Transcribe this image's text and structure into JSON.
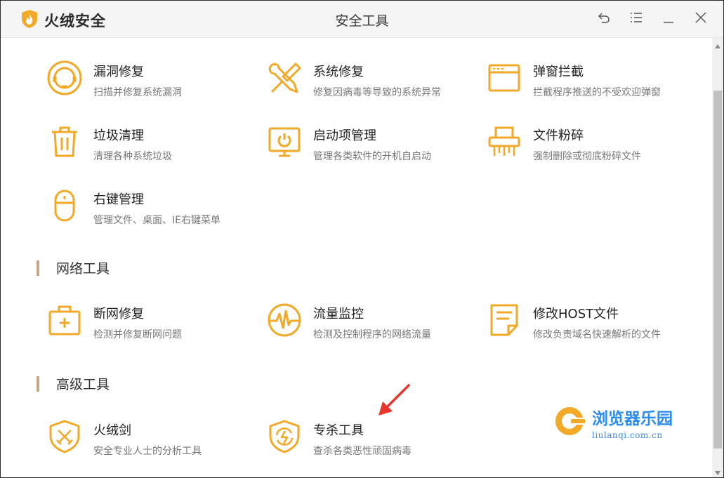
{
  "app": {
    "name": "火绒安全",
    "window_title": "安全工具"
  },
  "window_controls": [
    "back-icon",
    "menu-icon",
    "minimize-icon",
    "close-icon"
  ],
  "colors": {
    "accent": "#f2a928",
    "section_bar": "#c8a882",
    "watermark": "#2d8cf0"
  },
  "system_tools": [
    {
      "name": "漏洞修复",
      "desc": "扫描并修复系统漏洞",
      "icon": "vulnerability-fix-icon"
    },
    {
      "name": "系统修复",
      "desc": "修复因病毒等导致的系统异常",
      "icon": "wrench-screwdriver-icon"
    },
    {
      "name": "弹窗拦截",
      "desc": "拦截程序推送的不受欢迎弹窗",
      "icon": "popup-window-icon"
    },
    {
      "name": "垃圾清理",
      "desc": "清理各种系统垃圾",
      "icon": "trash-icon"
    },
    {
      "name": "启动项管理",
      "desc": "管理各类软件的开机自启动",
      "icon": "monitor-power-icon"
    },
    {
      "name": "文件粉碎",
      "desc": "强制删除或彻底粉碎文件",
      "icon": "shredder-icon"
    },
    {
      "name": "右键管理",
      "desc": "管理文件、桌面、IE右键菜单",
      "icon": "mouse-icon"
    }
  ],
  "network_section": {
    "title": "网络工具"
  },
  "network_tools": [
    {
      "name": "断网修复",
      "desc": "检测并修复断网问题",
      "icon": "first-aid-kit-icon"
    },
    {
      "name": "流量监控",
      "desc": "检测及控制程序的网络流量",
      "icon": "pulse-icon"
    },
    {
      "name": "修改HOST文件",
      "desc": "修改负责域名快速解析的文件",
      "icon": "document-edit-icon"
    }
  ],
  "advanced_section": {
    "title": "高级工具"
  },
  "advanced_tools": [
    {
      "name": "火绒剑",
      "desc": "安全专业人士的分析工具",
      "icon": "shield-sword-icon"
    },
    {
      "name": "专杀工具",
      "desc": "查杀各类恶性顽固病毒",
      "icon": "shield-bolt-icon"
    }
  ],
  "watermark": {
    "title": "浏览器乐园",
    "url": "liulanqi.com.cn"
  }
}
